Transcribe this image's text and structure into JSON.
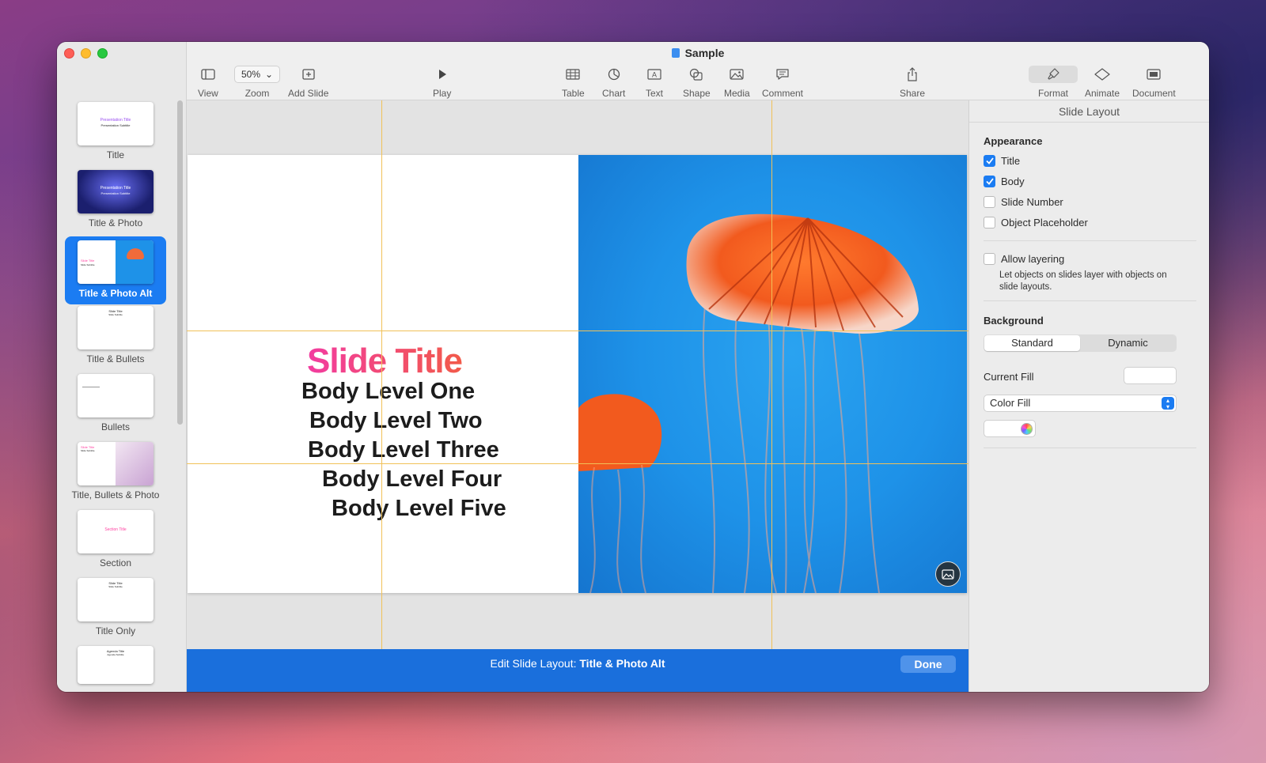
{
  "window": {
    "title": "Sample"
  },
  "toolbar": {
    "view": "View",
    "zoom_label": "Zoom",
    "zoom_value": "50%",
    "add_slide": "Add Slide",
    "play": "Play",
    "table": "Table",
    "chart": "Chart",
    "text": "Text",
    "shape": "Shape",
    "media": "Media",
    "comment": "Comment",
    "share": "Share",
    "format": "Format",
    "animate": "Animate",
    "document": "Document"
  },
  "sidebar": {
    "layouts": [
      {
        "label": "Title",
        "mini_title": "Presentation Title",
        "mini_sub": "Presentation Subtitle"
      },
      {
        "label": "Title & Photo",
        "mini_title": "Presentation Title",
        "mini_sub": "Presentation Subtitle"
      },
      {
        "label": "Title & Photo Alt",
        "mini_title": "Slide Title",
        "mini_sub": "Slide Subtitle"
      },
      {
        "label": "Title & Bullets",
        "mini_title": "Slide Title",
        "mini_sub": "Slide Subtitle"
      },
      {
        "label": "Bullets",
        "mini_title": "",
        "mini_sub": ""
      },
      {
        "label": "Title, Bullets & Photo",
        "mini_title": "Slide Title",
        "mini_sub": "Slide Subtitle"
      },
      {
        "label": "Section",
        "mini_title": "Section Title",
        "mini_sub": ""
      },
      {
        "label": "Title Only",
        "mini_title": "Slide Title",
        "mini_sub": "Slide Subtitle"
      },
      {
        "label": "",
        "mini_title": "Agenda Title",
        "mini_sub": "Agenda Subtitle"
      }
    ],
    "active_index": 2
  },
  "slide": {
    "title": "Slide Title",
    "body": [
      "Body Level One",
      "Body Level Two",
      "Body Level Three",
      "Body Level Four",
      "Body Level Five"
    ]
  },
  "editbar": {
    "prefix": "Edit Slide Layout: ",
    "layout_name": "Title & Photo Alt",
    "done": "Done"
  },
  "inspector": {
    "header": "Slide Layout",
    "appearance": {
      "title": "Appearance",
      "options": [
        {
          "label": "Title",
          "checked": true
        },
        {
          "label": "Body",
          "checked": true
        },
        {
          "label": "Slide Number",
          "checked": false
        },
        {
          "label": "Object Placeholder",
          "checked": false
        }
      ]
    },
    "layering": {
      "label": "Allow layering",
      "checked": false,
      "hint": "Let objects on slides layer with objects on slide layouts."
    },
    "background": {
      "title": "Background",
      "tabs": [
        "Standard",
        "Dynamic"
      ],
      "active_tab": "Standard",
      "current_fill_label": "Current Fill",
      "fill_type": "Color Fill"
    }
  },
  "colors": {
    "accent": "#1b7cf2",
    "editbar": "#1a6fdc",
    "title_gradient_start": "#f23ca0",
    "title_gradient_end": "#f25a4a",
    "guide": "#f1c158"
  }
}
